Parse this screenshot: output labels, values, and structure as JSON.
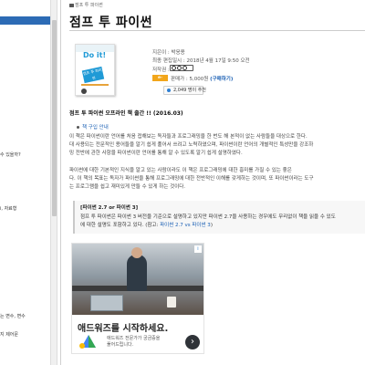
{
  "breadcrumb": {
    "text": "점프 투 파이썬"
  },
  "page": {
    "title": "점프 투 파이썬"
  },
  "sidebar": {
    "items": [
      {
        "label": "..."
      },
      {
        "label": "수 있을까?"
      },
      {
        "label": "i, 자료형"
      },
      {
        "label": "는 변수, 변수"
      },
      {
        "label": "지 제어문"
      }
    ]
  },
  "book": {
    "cover_text": "Do it!",
    "cover_tag": "점프 투 파이썬",
    "author": "지은이 : 박응용",
    "edited": "최종 편집일시 : 2018년 4월 17일 9:50 오전",
    "copyright_label": "저작권 :",
    "price_label": "e-book",
    "price_text": "판매가 : 5,000원",
    "buy_link": "(구매하기)",
    "recommend_count": "2,049 명이 추천"
  },
  "content": {
    "headline": "점프 투 파이썬 오프라인 책 출간 !! (2016.03)",
    "buy_guide": "책 구입 안내",
    "para1": [
      "이 책은 파이썬이란 언어를 처음 접해보는 독자들과 프로그래밍을 한 번도 해 본적이 없는 사람들을 대상으로 한다.",
      "대 사용되는 전문적인 용어들을 알기 쉽게 풀어서 쓰려고 노력하였으며, 파이썬이란 언어의 개별적인 특성만을 강조하",
      "밍 전반에 관한 사항을 파이썬이란 언어를 통해 알 수 있도록 알기 쉽게 설명하였다."
    ],
    "para2": [
      "파이썬에 대한 기본적인 지식을 알고 있는 사람이라도 이 책은 프로그래밍에 대한 흥미를 가질 수 있는 좋은",
      "다. 이 책의 목표는 독자가 파이썬을 통해 프로그래밍에 대한 전반적인 이해를 갖게하는 것이며, 또 파이썬이라는 도구",
      "는 프로그램을 쉽고 재미있게 만들 수 있게 하는 것이다."
    ],
    "note_title": "[파이썬 2.7 or 파이썬 3]",
    "note_line1": "점프 투 파이썬은 파이썬 3 버전을 기준으로 설명하고 있지만 파이썬 2.7을 사용하는 경우에도 무리없이 책을 읽을 수 있도",
    "note_line2_prefix": "에 대한 설명도 포함하고 있다. (참고: ",
    "note_link": "파이썬 2.7 vs 파이썬 3",
    "note_line2_suffix": ")"
  },
  "ad": {
    "headline": "애드워즈를 시작하세요.",
    "sub1": "애드워즈 전문가가 궁금증을",
    "sub2": "풀어드립니다.",
    "sub3": "",
    "go": "›",
    "info": "i"
  }
}
